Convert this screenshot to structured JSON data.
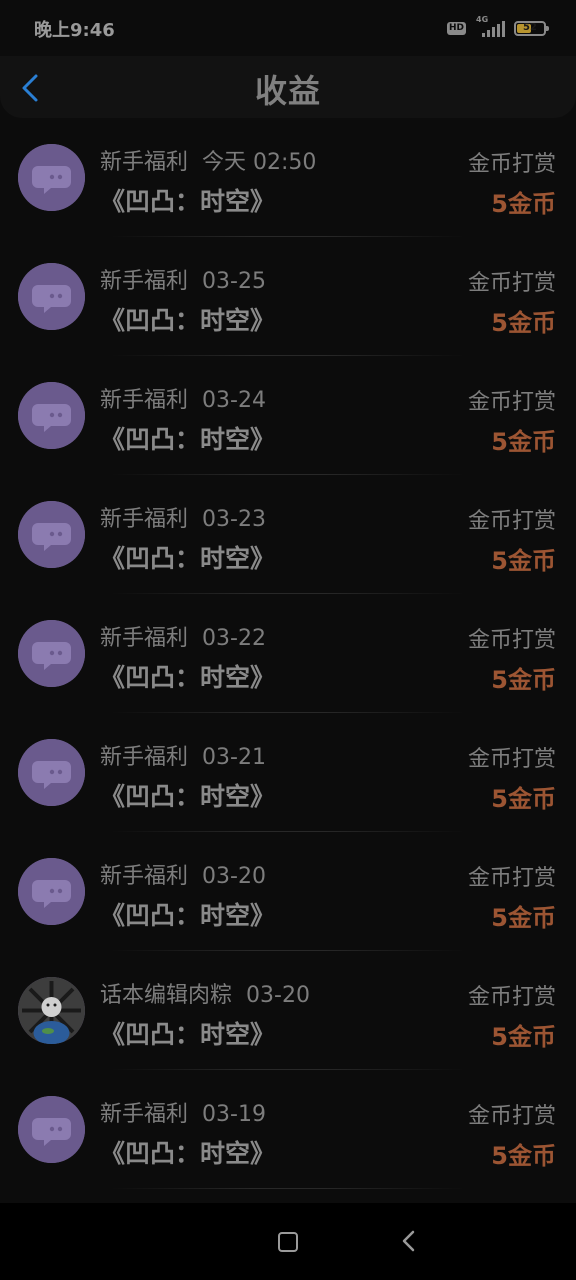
{
  "status_bar": {
    "time": "晚上9:46",
    "hd_label": "HD",
    "network_label": "4G",
    "battery_level": "52",
    "battery_fraction": 0.52
  },
  "header": {
    "title": "收益",
    "back_icon": "chevron-left-icon"
  },
  "colors": {
    "accent_blue": "#2a7fd4",
    "amount_orange": "#9c5533",
    "avatar_purple": "#6a5a8d"
  },
  "records": [
    {
      "source": "新手福利",
      "date": "今天 02:50",
      "title": "《凹凸：时空》",
      "type": "金币打赏",
      "amount": "5金币",
      "avatar": "chat-bubble-avatar"
    },
    {
      "source": "新手福利",
      "date": "03-25",
      "title": "《凹凸：时空》",
      "type": "金币打赏",
      "amount": "5金币",
      "avatar": "chat-bubble-avatar"
    },
    {
      "source": "新手福利",
      "date": "03-24",
      "title": "《凹凸：时空》",
      "type": "金币打赏",
      "amount": "5金币",
      "avatar": "chat-bubble-avatar"
    },
    {
      "source": "新手福利",
      "date": "03-23",
      "title": "《凹凸：时空》",
      "type": "金币打赏",
      "amount": "5金币",
      "avatar": "chat-bubble-avatar"
    },
    {
      "source": "新手福利",
      "date": "03-22",
      "title": "《凹凸：时空》",
      "type": "金币打赏",
      "amount": "5金币",
      "avatar": "chat-bubble-avatar"
    },
    {
      "source": "新手福利",
      "date": "03-21",
      "title": "《凹凸：时空》",
      "type": "金币打赏",
      "amount": "5金币",
      "avatar": "chat-bubble-avatar"
    },
    {
      "source": "新手福利",
      "date": "03-20",
      "title": "《凹凸：时空》",
      "type": "金币打赏",
      "amount": "5金币",
      "avatar": "chat-bubble-avatar"
    },
    {
      "source": "话本编辑肉粽",
      "date": "03-20",
      "title": "《凹凸：时空》",
      "type": "金币打赏",
      "amount": "5金币",
      "avatar": "user-photo-avatar"
    },
    {
      "source": "新手福利",
      "date": "03-19",
      "title": "《凹凸：时空》",
      "type": "金币打赏",
      "amount": "5金币",
      "avatar": "chat-bubble-avatar"
    }
  ],
  "nav_bar": {
    "home_icon": "square-home-icon",
    "back_icon": "chevron-left-icon"
  }
}
